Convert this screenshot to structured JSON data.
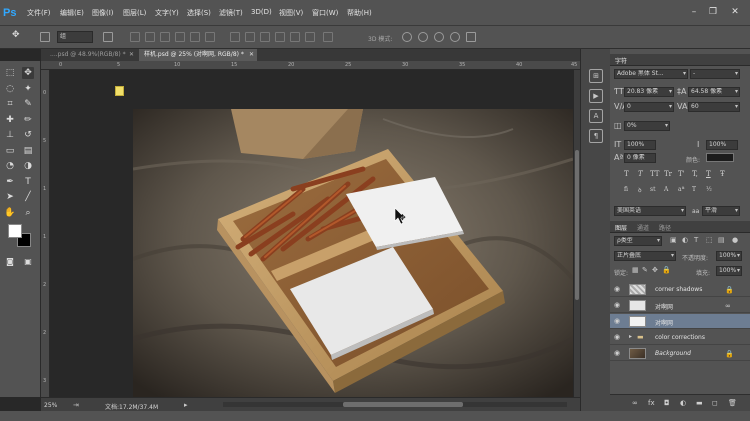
{
  "menubar": {
    "logo": "Ps",
    "items": [
      "文件(F)",
      "编辑(E)",
      "图像(I)",
      "图层(L)",
      "文字(Y)",
      "选择(S)",
      "滤镜(T)",
      "3D(D)",
      "视图(V)",
      "窗口(W)",
      "帮助(H)"
    ],
    "window_controls": {
      "minimize": "–",
      "restore": "❐",
      "close": "✕"
    }
  },
  "options_bar": {
    "auto_select_value": "组",
    "mode_3d_label": "3D 模式:"
  },
  "document_tabs": [
    {
      "label": "....psd @ 48.9%(RGB/8) *",
      "active": false,
      "close": "✕"
    },
    {
      "label": "样机.psd @ 25% (对啊网, RGB/8) *",
      "active": true,
      "close": "✕"
    }
  ],
  "rulers": {
    "top": [
      "0",
      "5",
      "10",
      "15",
      "20",
      "25",
      "30",
      "35",
      "40",
      "45"
    ],
    "left": [
      "0",
      "5",
      "1",
      "1",
      "2",
      "2",
      "3"
    ]
  },
  "toolbar": {
    "tools": [
      {
        "name": "marquee-tool",
        "glyph": "⬚"
      },
      {
        "name": "move-tool",
        "glyph": "✥",
        "active": true
      },
      {
        "name": "lasso-tool",
        "glyph": "◌"
      },
      {
        "name": "magic-wand-tool",
        "glyph": "✦"
      },
      {
        "name": "crop-tool",
        "glyph": "⌗"
      },
      {
        "name": "eyedropper-tool",
        "glyph": "✎"
      },
      {
        "name": "healing-tool",
        "glyph": "✚"
      },
      {
        "name": "brush-tool",
        "glyph": "✏"
      },
      {
        "name": "stamp-tool",
        "glyph": "⊥"
      },
      {
        "name": "history-brush-tool",
        "glyph": "↺"
      },
      {
        "name": "eraser-tool",
        "glyph": "▭"
      },
      {
        "name": "gradient-tool",
        "glyph": "▤"
      },
      {
        "name": "blur-tool",
        "glyph": "◔"
      },
      {
        "name": "dodge-tool",
        "glyph": "◑"
      },
      {
        "name": "pen-tool",
        "glyph": "✒"
      },
      {
        "name": "type-tool",
        "glyph": "T"
      },
      {
        "name": "path-select-tool",
        "glyph": "➤"
      },
      {
        "name": "line-tool",
        "glyph": "╱"
      },
      {
        "name": "hand-tool",
        "glyph": "✋"
      },
      {
        "name": "zoom-tool",
        "glyph": "⌕"
      }
    ]
  },
  "colors": {
    "foreground": "#ffffff",
    "background": "#000000",
    "selection": "#6d7d92",
    "photoshop_blue": "#31a8ff"
  },
  "status": {
    "zoom": "25%",
    "doc_info": "文档:17.2M/37.4M",
    "arrow": "▸"
  },
  "character_panel": {
    "tab": "字符",
    "font_family": "Adobe 黑体 St...",
    "font_style": "-",
    "font_size": "20.83 像素",
    "leading": "64.58 像素",
    "kerning": "0",
    "tracking": "60",
    "vertical_scale_left": "0%",
    "h_scale": "100%",
    "v_scale": "100%",
    "baseline": "0 像素",
    "color_label": "颜色:",
    "type_styles": [
      "T",
      "T",
      "TT",
      "Tr",
      "T'",
      "T,",
      "T",
      "Ŧ"
    ],
    "language": "美国英语",
    "antialias_label": "aa",
    "antialias": "平滑"
  },
  "layers_panel": {
    "tabs": [
      "图层",
      "通道",
      "路径"
    ],
    "filter_kind": "ρ类型",
    "blend_mode": "正片叠底",
    "opacity_label": "不透明度:",
    "opacity": "100%",
    "lock_label": "锁定:",
    "fill_label": "填充:",
    "fill": "100%",
    "layers": [
      {
        "name": "corner shadows",
        "italic": false,
        "selected": false,
        "lock": "🔒"
      },
      {
        "name": "对啊网",
        "italic": false,
        "selected": false,
        "lock": "∞"
      },
      {
        "name": "对啊网",
        "italic": false,
        "selected": true,
        "lock": ""
      },
      {
        "name": "color corrections",
        "italic": false,
        "selected": false,
        "lock": ""
      },
      {
        "name": "Background",
        "italic": true,
        "selected": false,
        "lock": "🔒"
      }
    ]
  }
}
